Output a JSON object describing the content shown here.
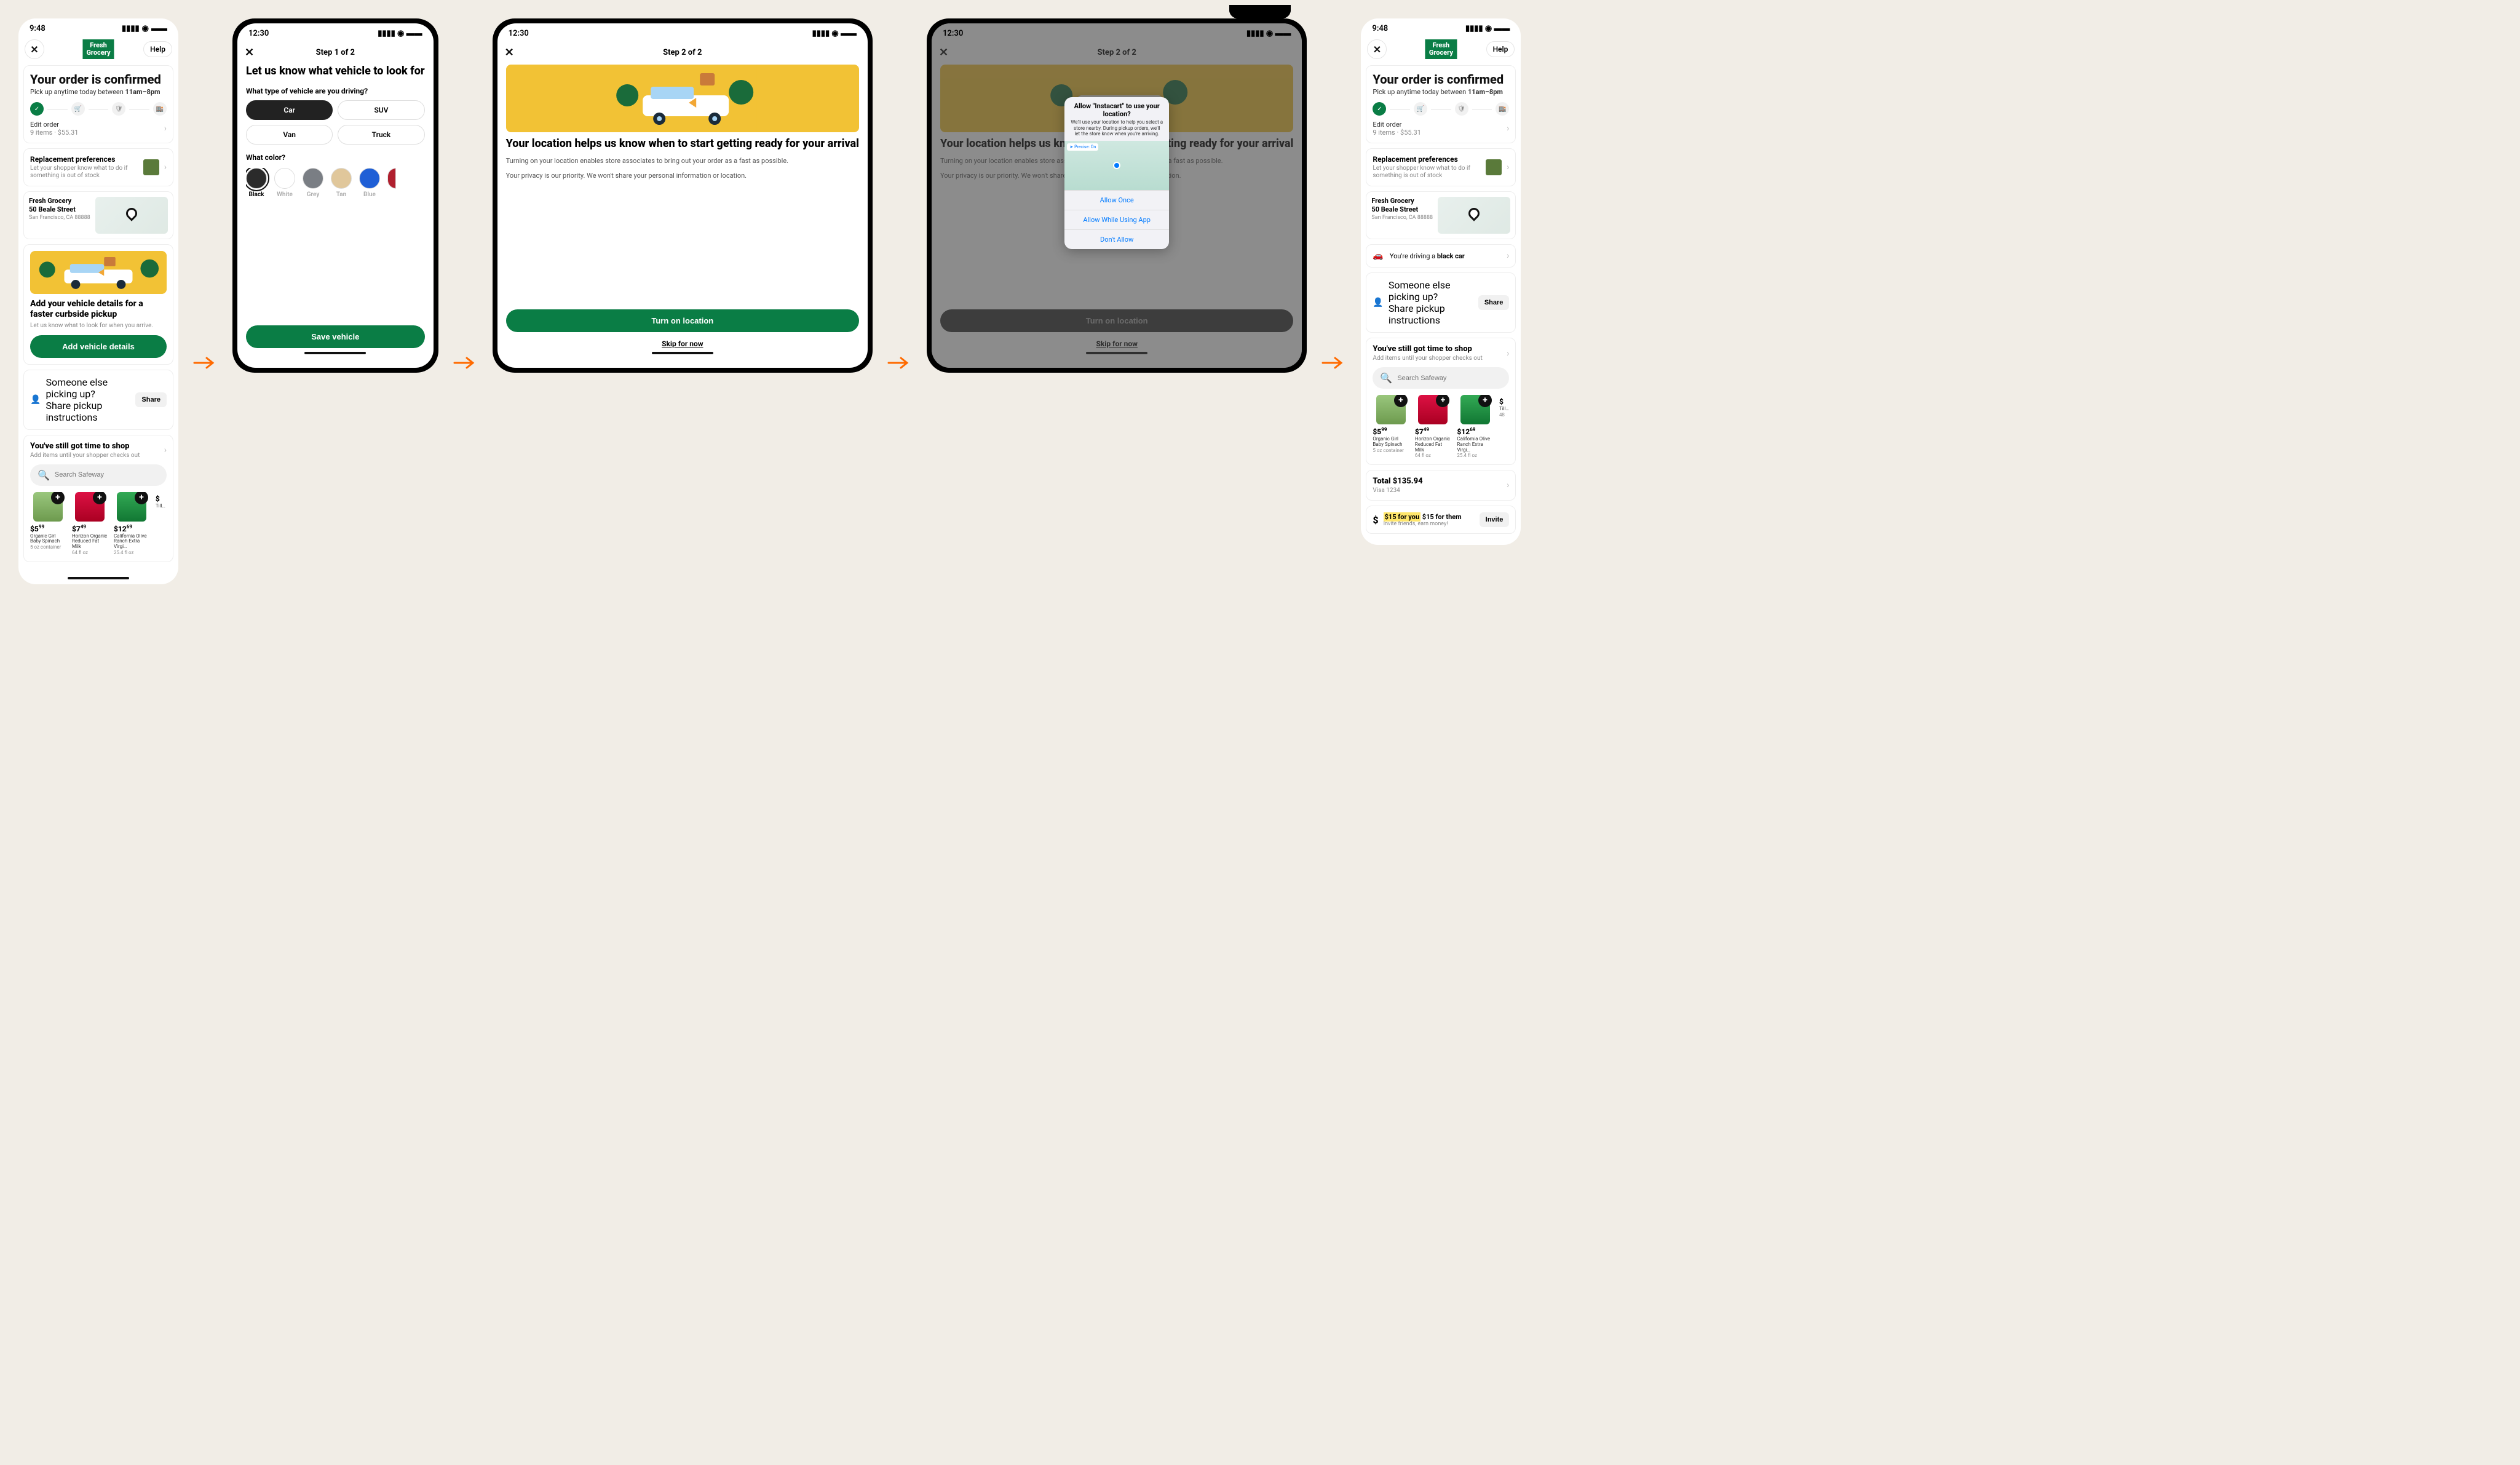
{
  "status_time_a": "9:48",
  "status_time_b": "12:30",
  "logo_line1": "Fresh",
  "logo_line2": "Grocery",
  "help": "Help",
  "confirm": {
    "title": "Your order is confirmed",
    "sub_prefix": "Pick up anytime today between ",
    "sub_time": "11am–8pm",
    "edit": "Edit order",
    "meta": "9 items · $55.31"
  },
  "repl": {
    "title": "Replacement preferences",
    "desc": "Let your shopper know what to do if something is out of stock"
  },
  "store": {
    "name": "Fresh Grocery",
    "addr1": "50 Beale Street",
    "addr2": "San Francisco, CA 88888"
  },
  "vehicle_card": {
    "title": "Add your vehicle details for a faster curbside pickup",
    "desc": "Let us know what to look for when you arrive.",
    "btn": "Add vehicle details"
  },
  "someone": {
    "title": "Someone else picking up?",
    "desc": "Share pickup instructions",
    "share": "Share"
  },
  "shop": {
    "title": "You've still got time to shop",
    "desc": "Add items until your shopper checks out",
    "search_placeholder": "Search Safeway"
  },
  "products": [
    {
      "price": "$5",
      "cents": "99",
      "name": "Organic Girl Baby Spinach",
      "size": "5 oz container"
    },
    {
      "price": "$7",
      "cents": "49",
      "name": "Horizon Organic Reduced Fat Milk",
      "size": "64 fl oz"
    },
    {
      "price": "$12",
      "cents": "69",
      "name": "California Olive Ranch Extra Virgi…",
      "size": "25.4 fl oz"
    },
    {
      "price": "$",
      "cents": "",
      "name": "Till…",
      "size": "48"
    }
  ],
  "step1": {
    "label": "Step 1 of 2",
    "h": "Let us know what vehicle to look for",
    "q1": "What type of vehicle are you driving?",
    "types": [
      "Car",
      "SUV",
      "Van",
      "Truck"
    ],
    "q2": "What color?",
    "colors": [
      {
        "n": "Black",
        "c": "#2b2b2b",
        "sel": true
      },
      {
        "n": "White",
        "c": "#ffffff"
      },
      {
        "n": "Grey",
        "c": "#7a7e84"
      },
      {
        "n": "Tan",
        "c": "#e0c79b"
      },
      {
        "n": "Blue",
        "c": "#1f5fd6"
      },
      {
        "n": "",
        "c": "#b01f2e"
      }
    ],
    "save": "Save vehicle"
  },
  "step2": {
    "label": "Step 2 of 2",
    "h": "Your location helps us know when to start getting ready for your arrival",
    "p1": "Turning on your location enables store associates to bring out your order as a fast as possible.",
    "p2": "Your privacy is our priority. We won't share your personal information or location.",
    "btn": "Turn on location",
    "skip": "Skip for now"
  },
  "alert": {
    "title": "Allow \"Instacart\" to use your location?",
    "desc": "We'll use your location to help you select a store nearby. During pickup orders, we'll let the store know when you're arriving.",
    "precise": "Precise: On",
    "opt1": "Allow Once",
    "opt2": "Allow While Using App",
    "opt3": "Don't Allow"
  },
  "driving": {
    "prefix": "You're driving a ",
    "car": "black car"
  },
  "total": {
    "title": "Total $135.94",
    "sub": "Visa 1234"
  },
  "invite": {
    "hl": "$15 for you",
    "rest": " $15 for them",
    "desc": "Invite friends, earn money!",
    "btn": "Invite"
  }
}
